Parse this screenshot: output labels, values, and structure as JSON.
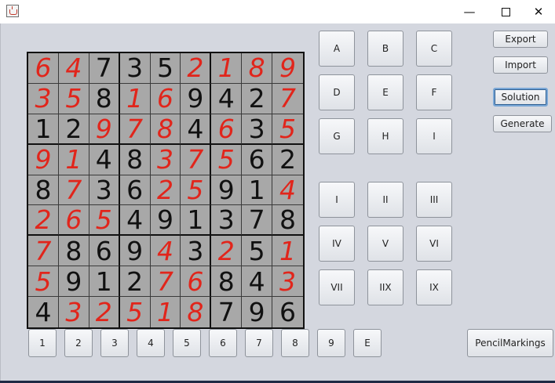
{
  "window": {
    "minimize_glyph": "—",
    "close_glyph": "✕",
    "app_icon": "java-cup-icon"
  },
  "board": {
    "cells": [
      [
        [
          "6",
          true
        ],
        [
          "4",
          true
        ],
        [
          "7",
          false
        ],
        [
          "3",
          false
        ],
        [
          "5",
          false
        ],
        [
          "2",
          true
        ],
        [
          "1",
          true
        ],
        [
          "8",
          true
        ],
        [
          "9",
          true
        ]
      ],
      [
        [
          "3",
          true
        ],
        [
          "5",
          true
        ],
        [
          "8",
          false
        ],
        [
          "1",
          true
        ],
        [
          "6",
          true
        ],
        [
          "9",
          false
        ],
        [
          "4",
          false
        ],
        [
          "2",
          false
        ],
        [
          "7",
          true
        ]
      ],
      [
        [
          "1",
          false
        ],
        [
          "2",
          false
        ],
        [
          "9",
          true
        ],
        [
          "7",
          true
        ],
        [
          "8",
          true
        ],
        [
          "4",
          false
        ],
        [
          "6",
          true
        ],
        [
          "3",
          false
        ],
        [
          "5",
          true
        ]
      ],
      [
        [
          "9",
          true
        ],
        [
          "1",
          true
        ],
        [
          "4",
          false
        ],
        [
          "8",
          false
        ],
        [
          "3",
          true
        ],
        [
          "7",
          true
        ],
        [
          "5",
          true
        ],
        [
          "6",
          false
        ],
        [
          "2",
          false
        ]
      ],
      [
        [
          "8",
          false
        ],
        [
          "7",
          true
        ],
        [
          "3",
          false
        ],
        [
          "6",
          false
        ],
        [
          "2",
          true
        ],
        [
          "5",
          true
        ],
        [
          "9",
          false
        ],
        [
          "1",
          false
        ],
        [
          "4",
          true
        ]
      ],
      [
        [
          "2",
          true
        ],
        [
          "6",
          true
        ],
        [
          "5",
          true
        ],
        [
          "4",
          false
        ],
        [
          "9",
          false
        ],
        [
          "1",
          false
        ],
        [
          "3",
          false
        ],
        [
          "7",
          false
        ],
        [
          "8",
          false
        ]
      ],
      [
        [
          "7",
          true
        ],
        [
          "8",
          false
        ],
        [
          "6",
          false
        ],
        [
          "9",
          false
        ],
        [
          "4",
          true
        ],
        [
          "3",
          false
        ],
        [
          "2",
          true
        ],
        [
          "5",
          false
        ],
        [
          "1",
          true
        ]
      ],
      [
        [
          "5",
          true
        ],
        [
          "9",
          false
        ],
        [
          "1",
          false
        ],
        [
          "2",
          false
        ],
        [
          "7",
          true
        ],
        [
          "6",
          true
        ],
        [
          "8",
          false
        ],
        [
          "4",
          false
        ],
        [
          "3",
          true
        ]
      ],
      [
        [
          "4",
          false
        ],
        [
          "3",
          true
        ],
        [
          "2",
          true
        ],
        [
          "5",
          true
        ],
        [
          "1",
          true
        ],
        [
          "8",
          true
        ],
        [
          "7",
          false
        ],
        [
          "9",
          false
        ],
        [
          "6",
          false
        ]
      ]
    ]
  },
  "letter_buttons": [
    "A",
    "B",
    "C",
    "D",
    "E",
    "F",
    "G",
    "H",
    "I"
  ],
  "roman_buttons": [
    "I",
    "II",
    "III",
    "IV",
    "V",
    "VI",
    "VII",
    "IIX",
    "IX"
  ],
  "number_buttons": [
    "1",
    "2",
    "3",
    "4",
    "5",
    "6",
    "7",
    "8",
    "9",
    "E"
  ],
  "side_buttons": {
    "export": "Export",
    "import": "Import",
    "solution": "Solution",
    "generate": "Generate"
  },
  "pencil_button": "PencilMarkings"
}
